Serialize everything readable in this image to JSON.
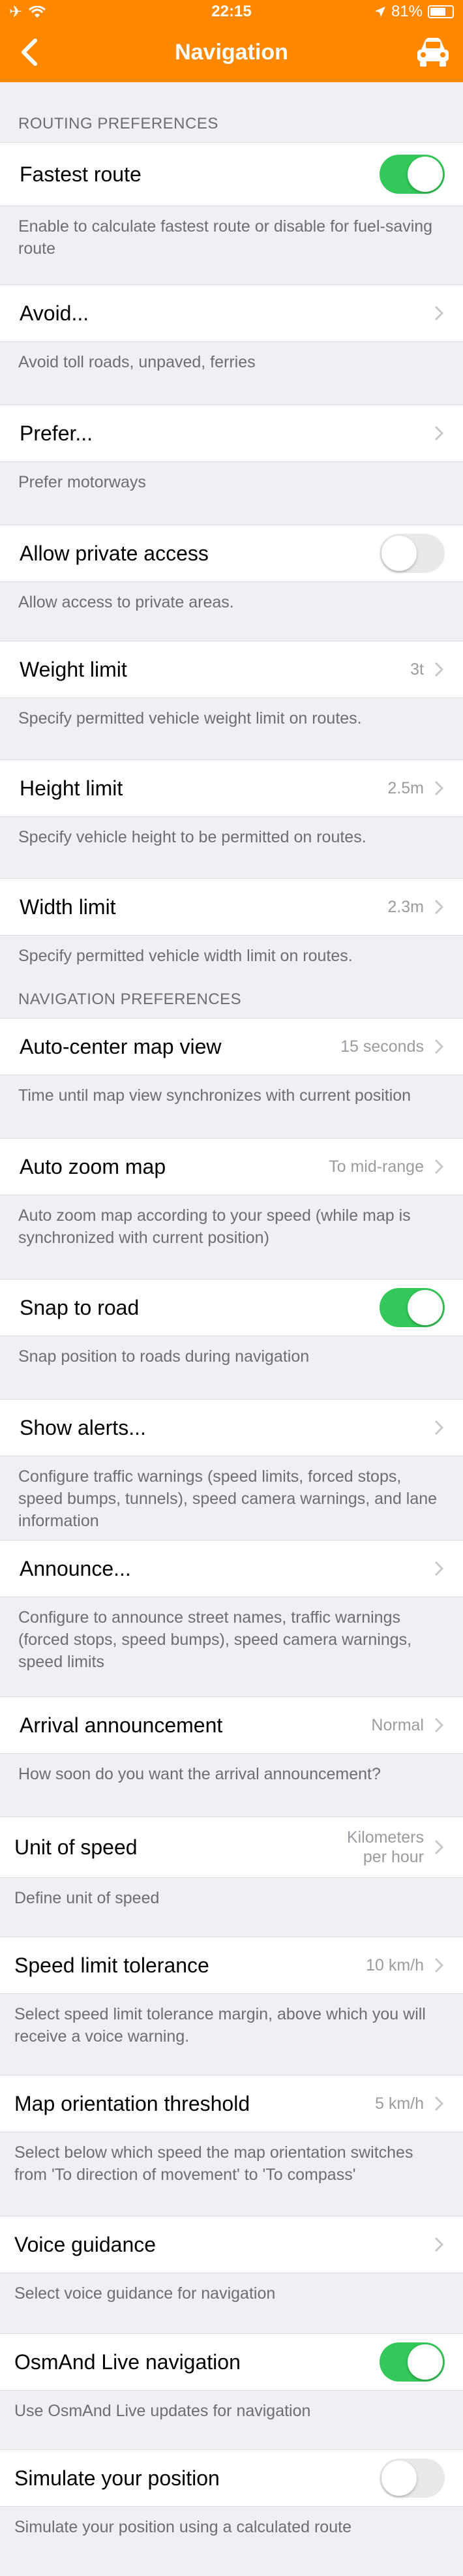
{
  "status": {
    "time": "22:15",
    "battery": "81%",
    "battery_level": 0.81
  },
  "header": {
    "title": "Navigation"
  },
  "colors": {
    "accent": "#ff8800",
    "toggle_on": "#34c759"
  },
  "sections": {
    "routing": "ROUTING PREFERENCES",
    "navigation": "NAVIGATION PREFERENCES"
  },
  "rows": {
    "fastest_route": {
      "label": "Fastest route",
      "on": true,
      "desc": "Enable to calculate fastest route or disable for fuel-saving route"
    },
    "avoid": {
      "label": "Avoid...",
      "desc": "Avoid toll roads, unpaved, ferries"
    },
    "prefer": {
      "label": "Prefer...",
      "desc": "Prefer motorways"
    },
    "private_access": {
      "label": "Allow private access",
      "on": false,
      "desc": "Allow access to private areas."
    },
    "weight_limit": {
      "label": "Weight limit",
      "value": "3t",
      "desc": "Specify permitted vehicle weight limit on routes."
    },
    "height_limit": {
      "label": "Height limit",
      "value": "2.5m",
      "desc": "Specify vehicle height to be permitted on routes."
    },
    "width_limit": {
      "label": "Width limit",
      "value": "2.3m",
      "desc": "Specify permitted vehicle width limit on routes."
    },
    "auto_center": {
      "label": "Auto-center map view",
      "value": "15 seconds",
      "desc": "Time until map view synchronizes with current position"
    },
    "auto_zoom": {
      "label": "Auto zoom map",
      "value": "To mid-range",
      "desc": "Auto zoom map according to your speed (while map is synchronized with current position)"
    },
    "snap_to_road": {
      "label": "Snap to road",
      "on": true,
      "desc": "Snap position to roads during navigation"
    },
    "show_alerts": {
      "label": "Show alerts...",
      "desc": "Configure traffic warnings (speed limits, forced stops, speed bumps, tunnels), speed camera warnings, and lane information"
    },
    "announce": {
      "label": "Announce...",
      "desc": "Configure to announce street names, traffic warnings (forced stops, speed bumps), speed camera warnings, speed limits"
    },
    "arrival": {
      "label": "Arrival announcement",
      "value": "Normal",
      "desc": "How soon do you want the arrival announcement?"
    },
    "unit_speed": {
      "label": "Unit of speed",
      "value_line1": "Kilometers",
      "value_line2": "per hour",
      "desc": "Define unit of speed"
    },
    "speed_tolerance": {
      "label": "Speed limit tolerance",
      "value": "10 km/h",
      "desc": "Select speed limit tolerance margin, above which you will receive a voice warning."
    },
    "map_orientation": {
      "label": "Map orientation threshold",
      "value": "5 km/h",
      "desc": "Select below which speed the map orientation switches from 'To direction of movement' to 'To compass'"
    },
    "voice_guidance": {
      "label": "Voice guidance",
      "desc": "Select voice guidance for navigation"
    },
    "osmand_live": {
      "label": "OsmAnd Live navigation",
      "on": true,
      "desc": "Use OsmAnd Live updates for navigation"
    },
    "simulate": {
      "label": "Simulate your position",
      "on": false,
      "desc": "Simulate your position using a calculated route"
    }
  }
}
